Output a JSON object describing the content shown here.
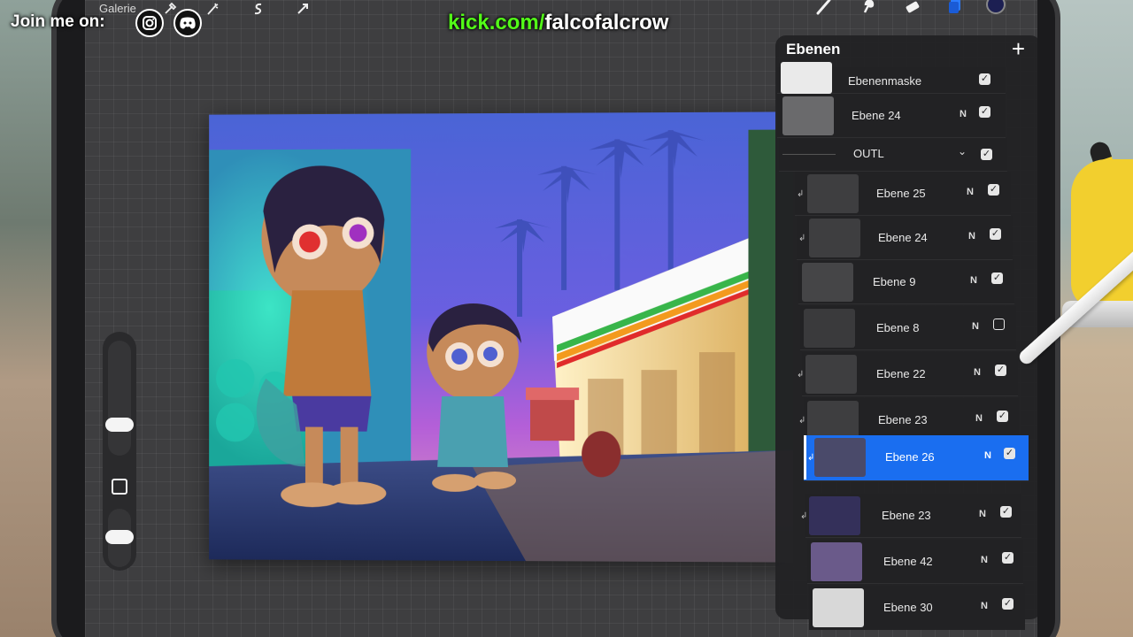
{
  "stream_overlay": {
    "join_label": "Join me on:",
    "social_icons": [
      "instagram-icon",
      "discord-icon"
    ],
    "kick_domain": "kick.com/",
    "kick_user": "falcofalcrow"
  },
  "toolbar": {
    "gallery_label": "Galerie",
    "left_tools": [
      "actions-icon",
      "adjustments-icon",
      "selection-icon",
      "transform-icon"
    ],
    "right_tools": [
      "brush-icon",
      "smudge-icon",
      "eraser-icon",
      "layers-icon"
    ],
    "active_color": "#1c1f52"
  },
  "layers_panel": {
    "title": "Ebenen",
    "add_label": "+",
    "layers": [
      {
        "name": "Ebenenmaske",
        "blend": "",
        "visible": true,
        "clipped": false,
        "selected": false
      },
      {
        "name": "Ebene 24",
        "blend": "N",
        "visible": true,
        "clipped": false,
        "selected": false
      },
      {
        "name": "OUTL",
        "blend": "",
        "visible": true,
        "clipped": false,
        "selected": false,
        "is_group": true
      },
      {
        "name": "Ebene 25",
        "blend": "N",
        "visible": true,
        "clipped": true,
        "selected": false
      },
      {
        "name": "Ebene 24",
        "blend": "N",
        "visible": true,
        "clipped": true,
        "selected": false
      },
      {
        "name": "Ebene 9",
        "blend": "N",
        "visible": true,
        "clipped": false,
        "selected": false
      },
      {
        "name": "Ebene 8",
        "blend": "N",
        "visible": false,
        "clipped": false,
        "selected": false
      },
      {
        "name": "Ebene 22",
        "blend": "N",
        "visible": true,
        "clipped": true,
        "selected": false
      },
      {
        "name": "Ebene 23",
        "blend": "N",
        "visible": true,
        "clipped": true,
        "selected": false
      },
      {
        "name": "Ebene 26",
        "blend": "N",
        "visible": true,
        "clipped": true,
        "selected": true
      },
      {
        "name": "Ebene 23",
        "blend": "N",
        "visible": true,
        "clipped": true,
        "selected": false
      },
      {
        "name": "Ebene 42",
        "blend": "N",
        "visible": true,
        "clipped": false,
        "selected": false
      },
      {
        "name": "Ebene 30",
        "blend": "N",
        "visible": true,
        "clipped": false,
        "selected": false
      }
    ]
  },
  "colors": {
    "selection_blue": "#1a6ef0",
    "kick_green": "#53fc18",
    "canvas_sky_top": "#4a64d6",
    "canvas_sky_bottom": "#b45fd8"
  }
}
